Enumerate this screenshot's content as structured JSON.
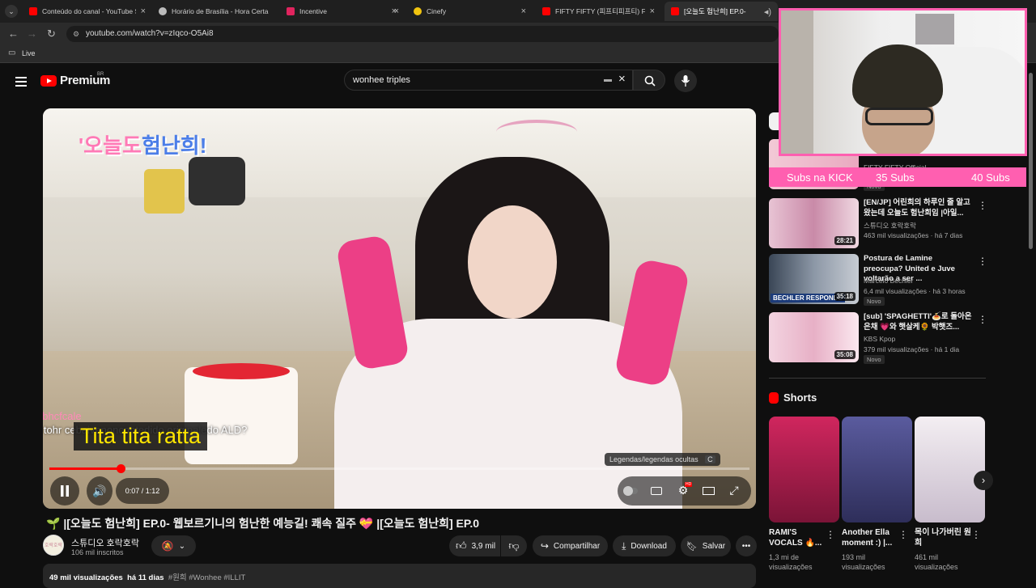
{
  "browser": {
    "tabs": [
      {
        "title": "Conteúdo do canal - YouTube S",
        "color": "#ff0000"
      },
      {
        "title": "Horário de Brasília - Hora Certa",
        "color": "#bbbbbb"
      },
      {
        "title": "Incentive",
        "color": "#e0245e"
      },
      {
        "title": "Cinefy",
        "color": "#f1c40f"
      },
      {
        "title": "FIFTY FIFTY (피프티피프티) FIFT",
        "color": "#ff0000"
      },
      {
        "title": "[오늘도 험난희] EP.0-",
        "color": "#ff0000"
      }
    ],
    "url": "youtube.com/watch?v=zIqco-O5Ai8",
    "bookmark": "Live"
  },
  "header": {
    "logo": "Premium",
    "region": "BR",
    "search_query": "wonhee triples"
  },
  "player": {
    "logo_a": "'오늘도",
    "logo_b": "험난희!",
    "sub_small": "o tohr cebaivenoncontedido originaledo ALD?",
    "sub_small_2": "ftbhcfcale",
    "sub_big": "Tita tita ratta",
    "cc_tooltip": "Legendas/legendas ocultas",
    "cc_key": "C",
    "time": "0:07 / 1:12",
    "progress": 0.1
  },
  "video": {
    "title": "🌱 |[오늘도 험난희] EP.0- 웹보르기니의 험난한 예능길! 쾌속 질주 💝 |[오늘도 험난희] EP.0",
    "channel": "스튜디오 호락호락",
    "channel_avatar": "호락호락",
    "subs": "106 mil inscritos",
    "likes": "3,9 mil",
    "share": "Compartilhar",
    "download": "Download",
    "save": "Salvar",
    "views": "49 mil visualizações",
    "age": "há 11 dias",
    "tags": "#원희 #Wonhee #ILLIT"
  },
  "overlay": {
    "label": "Subs na KICK",
    "goal_a": "35 Subs",
    "goal_b": "40 Subs"
  },
  "recommendations": [
    {
      "title": "",
      "channel": "FIFTY FIFTY Official",
      "meta": "",
      "badge": "Novo",
      "duration": ""
    },
    {
      "title": "[EN/JP] 어린희의 하루인 줄 알고 왔는데 오늘도 험난희임 |아일...",
      "channel": "스튜디오 호락호락",
      "meta": "463 mil visualizações · há 7 dias",
      "badge": "",
      "duration": "28:21"
    },
    {
      "title": "Postura de Lamine preocupa? United e Juve voltarão a ser ...",
      "channel": "Marcelo Bechler",
      "meta": "6,4 mil visualizações · há 3 horas",
      "badge": "Novo",
      "duration": "35:18"
    },
    {
      "title": "[sub] 'SPAGHETTI'🍝로 돌아온 은채 💗와 햇살케🌻 박햇즈...",
      "channel": "KBS Kpop",
      "meta": "379 mil visualizações · há 1 dia",
      "badge": "Novo",
      "duration": "35:08"
    }
  ],
  "shorts": {
    "heading": "Shorts",
    "items": [
      {
        "title": "RAMI'S VOCALS 🔥...",
        "meta": "1,3 mi de visualizações",
        "color": "#b21d54"
      },
      {
        "title": "Another Ella moment :) |...",
        "meta": "193 mil visualizações",
        "color": "#4a4a8a"
      },
      {
        "title": "목이 나가버린 원희",
        "meta": "461 mil visualizações",
        "color": "#e9e4ec"
      }
    ]
  },
  "thumb_texts": {
    "bechler": "BECHLER RESPONDE"
  }
}
